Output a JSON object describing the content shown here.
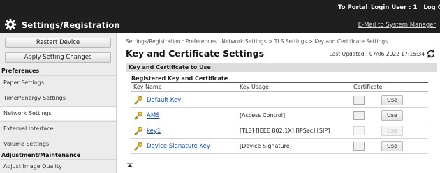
{
  "header": {
    "portal": "To Portal",
    "login_label": "Login User :",
    "login_user": "1",
    "logout": "Log Out",
    "title": "Settings/Registration",
    "email_link": "E-Mail to System Manager"
  },
  "sidebar": {
    "restart_button": "Restart Device",
    "apply_button": "Apply Setting Changes",
    "group_preferences": "Preferences",
    "items": [
      {
        "label": "Paper Settings"
      },
      {
        "label": "Timer/Energy Settings"
      },
      {
        "label": "Network Settings"
      },
      {
        "label": "External Interface"
      },
      {
        "label": "Volume Settings"
      }
    ],
    "group_adjust": "Adjustment/Maintenance",
    "adjust_items": [
      {
        "label": "Adjust Image Quality"
      }
    ]
  },
  "main": {
    "breadcrumb": "Settings/Registration : Preferences : Network Settings > TLS Settings > Key and Certificate Settings",
    "title": "Key and Certificate Settings",
    "last_updated": "Last Updated : 07/06 2022 17:15:34",
    "section": "Key and Certificate to Use",
    "subsection": "Registered Key and Certificate",
    "columns": {
      "name": "Key Name",
      "usage": "Key Usage",
      "cert": "Certificate"
    },
    "rows": [
      {
        "name": "Default Key",
        "usage": "",
        "use": "Use",
        "enabled": true
      },
      {
        "name": "AMS",
        "usage": "[Access Control]",
        "use": "Use",
        "enabled": true
      },
      {
        "name": "key1",
        "usage": "[TLS] [IEEE 802.1X] [IPSec] [SIP]",
        "use": "Use",
        "enabled": false
      },
      {
        "name": "Device Signature Key",
        "usage": "[Device Signature]",
        "use": "Use",
        "enabled": true
      }
    ]
  },
  "colors": {
    "topbar": "#1f1f1f",
    "link": "#1a4ba8",
    "key_icon": "#d8b020"
  }
}
